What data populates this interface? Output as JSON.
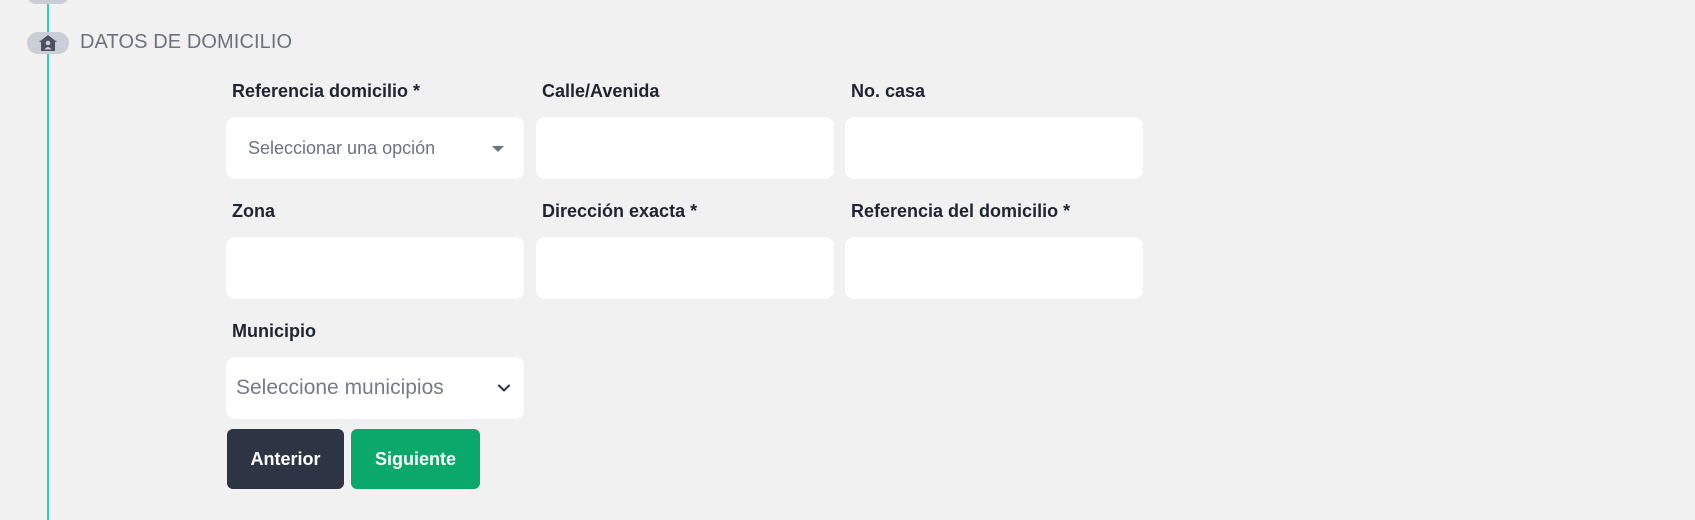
{
  "step": {
    "title": "DATOS DE DOMICILIO",
    "icon": "home-icon"
  },
  "fields": [
    {
      "label": "Referencia domicilio *",
      "type": "select",
      "value": "Seleccionar una opción"
    },
    {
      "label": "Calle/Avenida",
      "type": "text",
      "value": ""
    },
    {
      "label": "No. casa",
      "type": "text",
      "value": ""
    },
    {
      "label": "Zona",
      "type": "text",
      "value": ""
    },
    {
      "label": "Dirección exacta *",
      "type": "text",
      "value": ""
    },
    {
      "label": "Referencia del domicilio *",
      "type": "text",
      "value": ""
    },
    {
      "label": "Municipio",
      "type": "select",
      "placeholder": "Seleccione municipios"
    }
  ],
  "buttons": {
    "previous": "Anterior",
    "next": "Siguiente"
  },
  "colors": {
    "background": "#f1f1f1",
    "timeline": "#35c6c8",
    "primary_dark": "#2d3443",
    "success": "#0aa86a"
  }
}
